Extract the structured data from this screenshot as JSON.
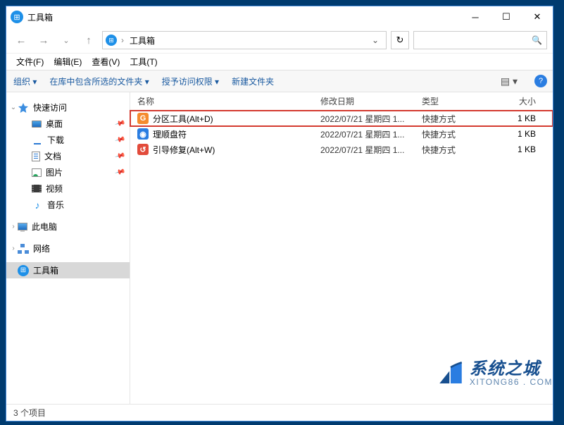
{
  "title": "工具箱",
  "address": {
    "crumb0": "工具箱"
  },
  "search_placeholder": "",
  "menubar": [
    "文件(F)",
    "编辑(E)",
    "查看(V)",
    "工具(T)"
  ],
  "cmdbar": {
    "organize": "组织 ▾",
    "include": "在库中包含所选的文件夹 ▾",
    "grant": "授予访问权限 ▾",
    "newfolder": "新建文件夹"
  },
  "sidebar": {
    "quick": "快速访问",
    "desktop": "桌面",
    "downloads": "下载",
    "documents": "文档",
    "pictures": "图片",
    "videos": "视频",
    "music": "音乐",
    "thispc": "此电脑",
    "network": "网络",
    "toolbox": "工具箱"
  },
  "columns": {
    "name": "名称",
    "date": "修改日期",
    "type": "类型",
    "size": "大小"
  },
  "rows": [
    {
      "name": "分区工具(Alt+D)",
      "date": "2022/07/21 星期四 1...",
      "type": "快捷方式",
      "size": "1 KB",
      "icon": "orange",
      "hl": true
    },
    {
      "name": "理顺盘符",
      "date": "2022/07/21 星期四 1...",
      "type": "快捷方式",
      "size": "1 KB",
      "icon": "blue",
      "hl": false
    },
    {
      "name": "引导修复(Alt+W)",
      "date": "2022/07/21 星期四 1...",
      "type": "快捷方式",
      "size": "1 KB",
      "icon": "red",
      "hl": false
    }
  ],
  "status": "3 个项目",
  "watermark": {
    "t1": "系统之城",
    "t2": "XITONG86 . COM"
  }
}
